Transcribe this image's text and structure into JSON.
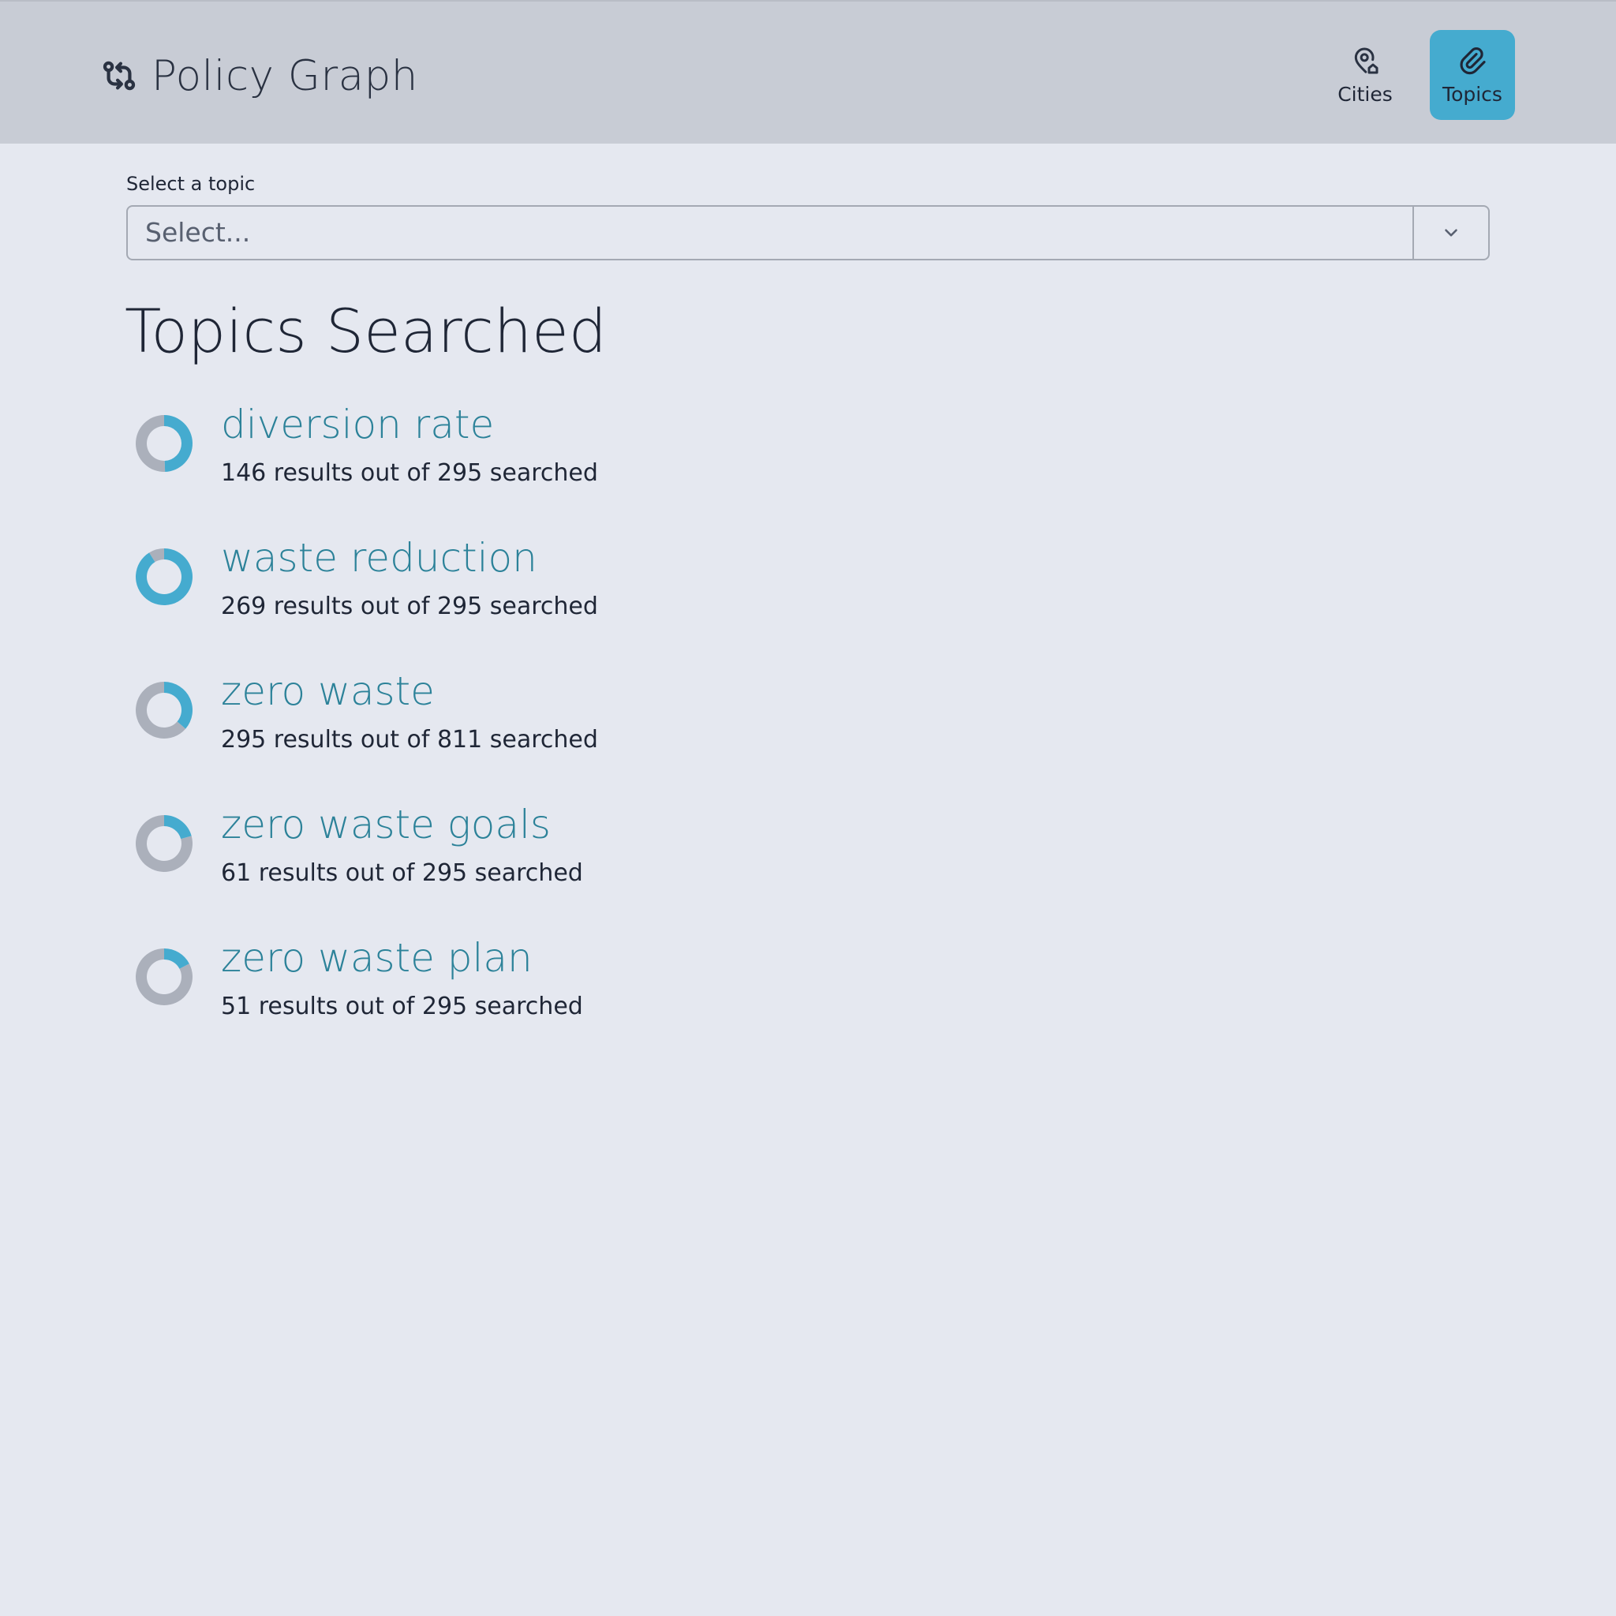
{
  "header": {
    "title": "Policy Graph",
    "logo_icon": "git-compare-icon",
    "nav": [
      {
        "label": "Cities",
        "icon": "map-pin-home-icon",
        "active": false
      },
      {
        "label": "Topics",
        "icon": "paperclip-icon",
        "active": true
      }
    ]
  },
  "colors": {
    "header_bg": "#c8ccd5",
    "page_bg": "#e5e8f0",
    "accent": "#45abcf",
    "donut_rest": "#abb0bb",
    "topic_link": "#2c8299"
  },
  "topic_select": {
    "label": "Select a topic",
    "placeholder": "Select..."
  },
  "main": {
    "heading": "Topics Searched"
  },
  "topics": [
    {
      "name": "diversion rate",
      "summary": "146 results out of 295 searched",
      "results": 146,
      "searched": 295
    },
    {
      "name": "waste reduction",
      "summary": "269 results out of 295 searched",
      "results": 269,
      "searched": 295
    },
    {
      "name": "zero waste",
      "summary": "295 results out of 811 searched",
      "results": 295,
      "searched": 811
    },
    {
      "name": "zero waste goals",
      "summary": "61 results out of 295 searched",
      "results": 61,
      "searched": 295
    },
    {
      "name": "zero waste plan",
      "summary": "51 results out of 295 searched",
      "results": 51,
      "searched": 295
    }
  ]
}
